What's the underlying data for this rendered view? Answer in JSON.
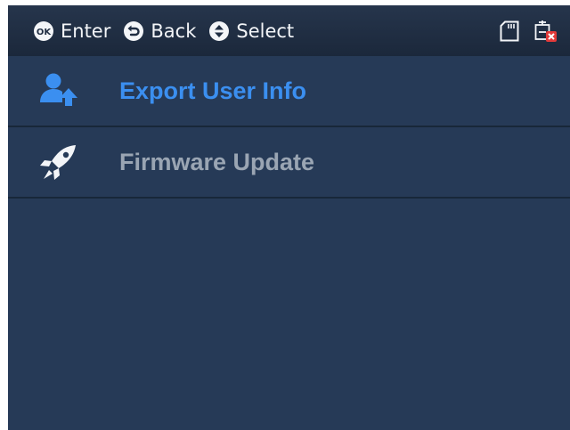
{
  "hints": {
    "enter_label": "Enter",
    "back_label": "Back",
    "select_label": "Select"
  },
  "status": {
    "icons": [
      "sd-card-icon",
      "network-disconnected-icon"
    ]
  },
  "menu": {
    "items": [
      {
        "label": "Export User Info",
        "icon": "user-upload-icon",
        "selected": true
      },
      {
        "label": "Firmware Update",
        "icon": "rocket-icon",
        "selected": false
      }
    ]
  },
  "colors": {
    "background": "#263a57",
    "topbar": "#1f2d42",
    "selected_text": "#3b8ff0",
    "normal_text": "#9aa5b3",
    "divider": "#182739"
  }
}
